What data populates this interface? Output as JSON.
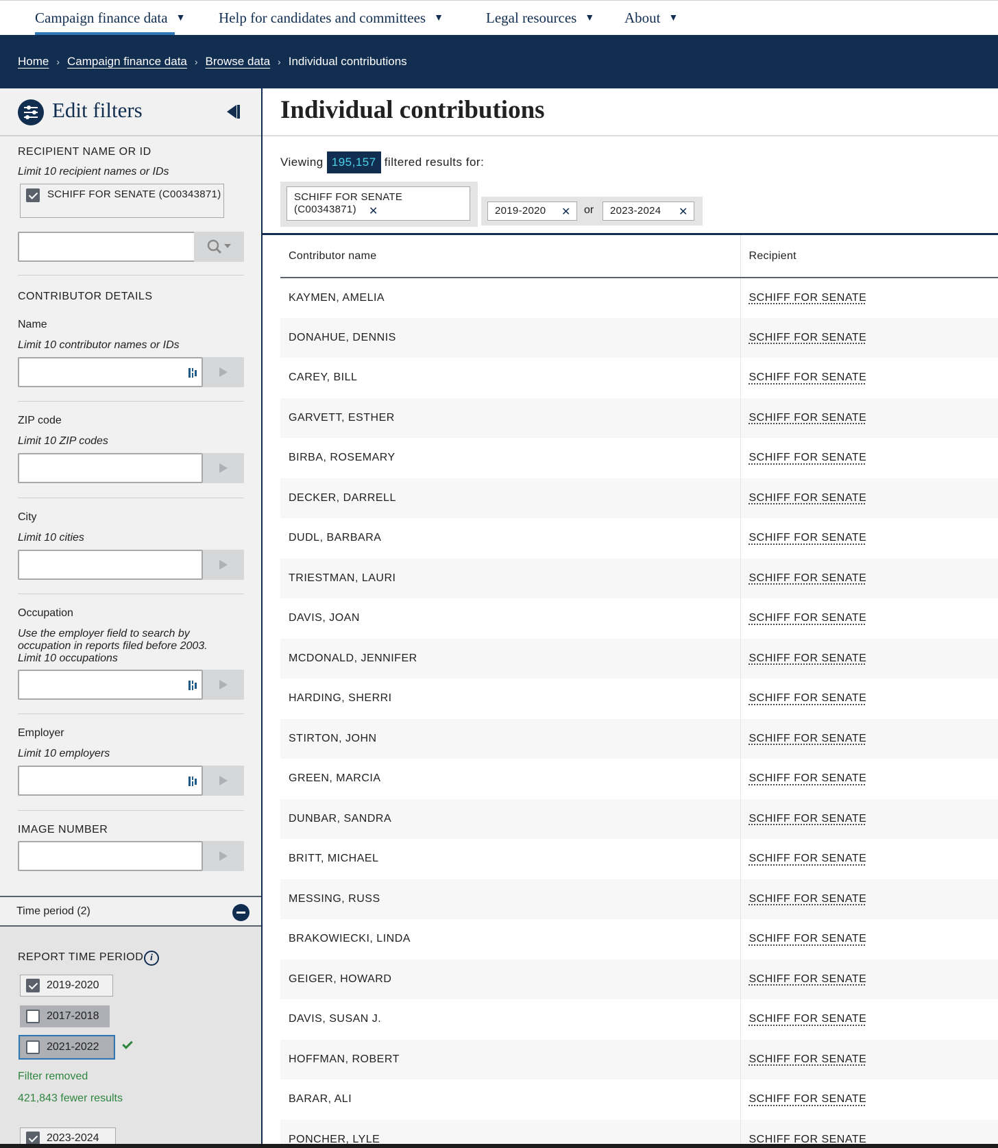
{
  "topnav": {
    "items": [
      {
        "label": "Campaign finance data"
      },
      {
        "label": "Help for candidates and committees"
      },
      {
        "label": "Legal resources"
      },
      {
        "label": "About"
      }
    ]
  },
  "breadcrumb": {
    "items": [
      "Home",
      "Campaign finance data",
      "Browse data"
    ],
    "current": "Individual contributions"
  },
  "sidebar": {
    "title": "Edit filters",
    "recipient": {
      "section_label": "RECIPIENT NAME OR ID",
      "hint": "Limit 10 recipient names or IDs",
      "selected": "SCHIFF FOR SENATE (C00343871)",
      "input_value": ""
    },
    "contributor": {
      "section_label": "CONTRIBUTOR DETAILS",
      "name_label": "Name",
      "name_hint": "Limit 10 contributor names or IDs",
      "zip_label": "ZIP code",
      "zip_hint": "Limit 10 ZIP codes",
      "city_label": "City",
      "city_hint": "Limit 10 cities",
      "occupation_label": "Occupation",
      "occupation_hint": "Use the employer field to search by occupation in reports filed before 2003. Limit 10 occupations",
      "employer_label": "Employer",
      "employer_hint": "Limit 10 employers"
    },
    "image_number": {
      "section_label": "IMAGE NUMBER"
    },
    "time_period": {
      "toggle_label": "Time period (2)",
      "section_label": "REPORT TIME PERIOD",
      "periods": [
        {
          "label": "2019-2020",
          "checked": true
        },
        {
          "label": "2017-2018",
          "checked": false
        },
        {
          "label": "2021-2022",
          "checked": false
        },
        {
          "label": "2023-2024",
          "checked": true
        }
      ],
      "status": "Filter removed",
      "status_detail": "421,843 fewer results"
    }
  },
  "main": {
    "title": "Individual contributions",
    "viewing_prefix": "Viewing",
    "count": "195,157",
    "viewing_suffix": "filtered results for:",
    "filter_tags": {
      "recipient": "SCHIFF FOR SENATE (C00343871)",
      "period_a": "2019-2020",
      "or": "or",
      "period_b": "2023-2024"
    },
    "table": {
      "columns": [
        "Contributor name",
        "Recipient"
      ],
      "rows": [
        [
          "KAYMEN, AMELIA",
          "SCHIFF FOR SENATE"
        ],
        [
          "DONAHUE, DENNIS",
          "SCHIFF FOR SENATE"
        ],
        [
          "CAREY, BILL",
          "SCHIFF FOR SENATE"
        ],
        [
          "GARVETT, ESTHER",
          "SCHIFF FOR SENATE"
        ],
        [
          "BIRBA, ROSEMARY",
          "SCHIFF FOR SENATE"
        ],
        [
          "DECKER, DARRELL",
          "SCHIFF FOR SENATE"
        ],
        [
          "DUDL, BARBARA",
          "SCHIFF FOR SENATE"
        ],
        [
          "TRIESTMAN, LAURI",
          "SCHIFF FOR SENATE"
        ],
        [
          "DAVIS, JOAN",
          "SCHIFF FOR SENATE"
        ],
        [
          "MCDONALD, JENNIFER",
          "SCHIFF FOR SENATE"
        ],
        [
          "HARDING, SHERRI",
          "SCHIFF FOR SENATE"
        ],
        [
          "STIRTON, JOHN",
          "SCHIFF FOR SENATE"
        ],
        [
          "GREEN, MARCIA",
          "SCHIFF FOR SENATE"
        ],
        [
          "DUNBAR, SANDRA",
          "SCHIFF FOR SENATE"
        ],
        [
          "BRITT, MICHAEL",
          "SCHIFF FOR SENATE"
        ],
        [
          "MESSING, RUSS",
          "SCHIFF FOR SENATE"
        ],
        [
          "BRAKOWIECKI, LINDA",
          "SCHIFF FOR SENATE"
        ],
        [
          "GEIGER, HOWARD",
          "SCHIFF FOR SENATE"
        ],
        [
          "DAVIS, SUSAN J.",
          "SCHIFF FOR SENATE"
        ],
        [
          "HOFFMAN, ROBERT",
          "SCHIFF FOR SENATE"
        ],
        [
          "BARAR, ALI",
          "SCHIFF FOR SENATE"
        ],
        [
          "PONCHER, LYLE",
          "SCHIFF FOR SENATE"
        ]
      ]
    }
  },
  "colors": {
    "navy": "#112e51",
    "accent_blue": "#2e78b7",
    "count_text": "#4bd1e6",
    "success_green": "#2e8540"
  },
  "icons": [
    "chevron-down-icon",
    "filter-sliders-icon",
    "collapse-panel-icon",
    "search-icon",
    "play-arrow-icon",
    "keyboard-icon",
    "minus-circle-icon",
    "info-icon",
    "checkmark-icon",
    "close-icon"
  ]
}
